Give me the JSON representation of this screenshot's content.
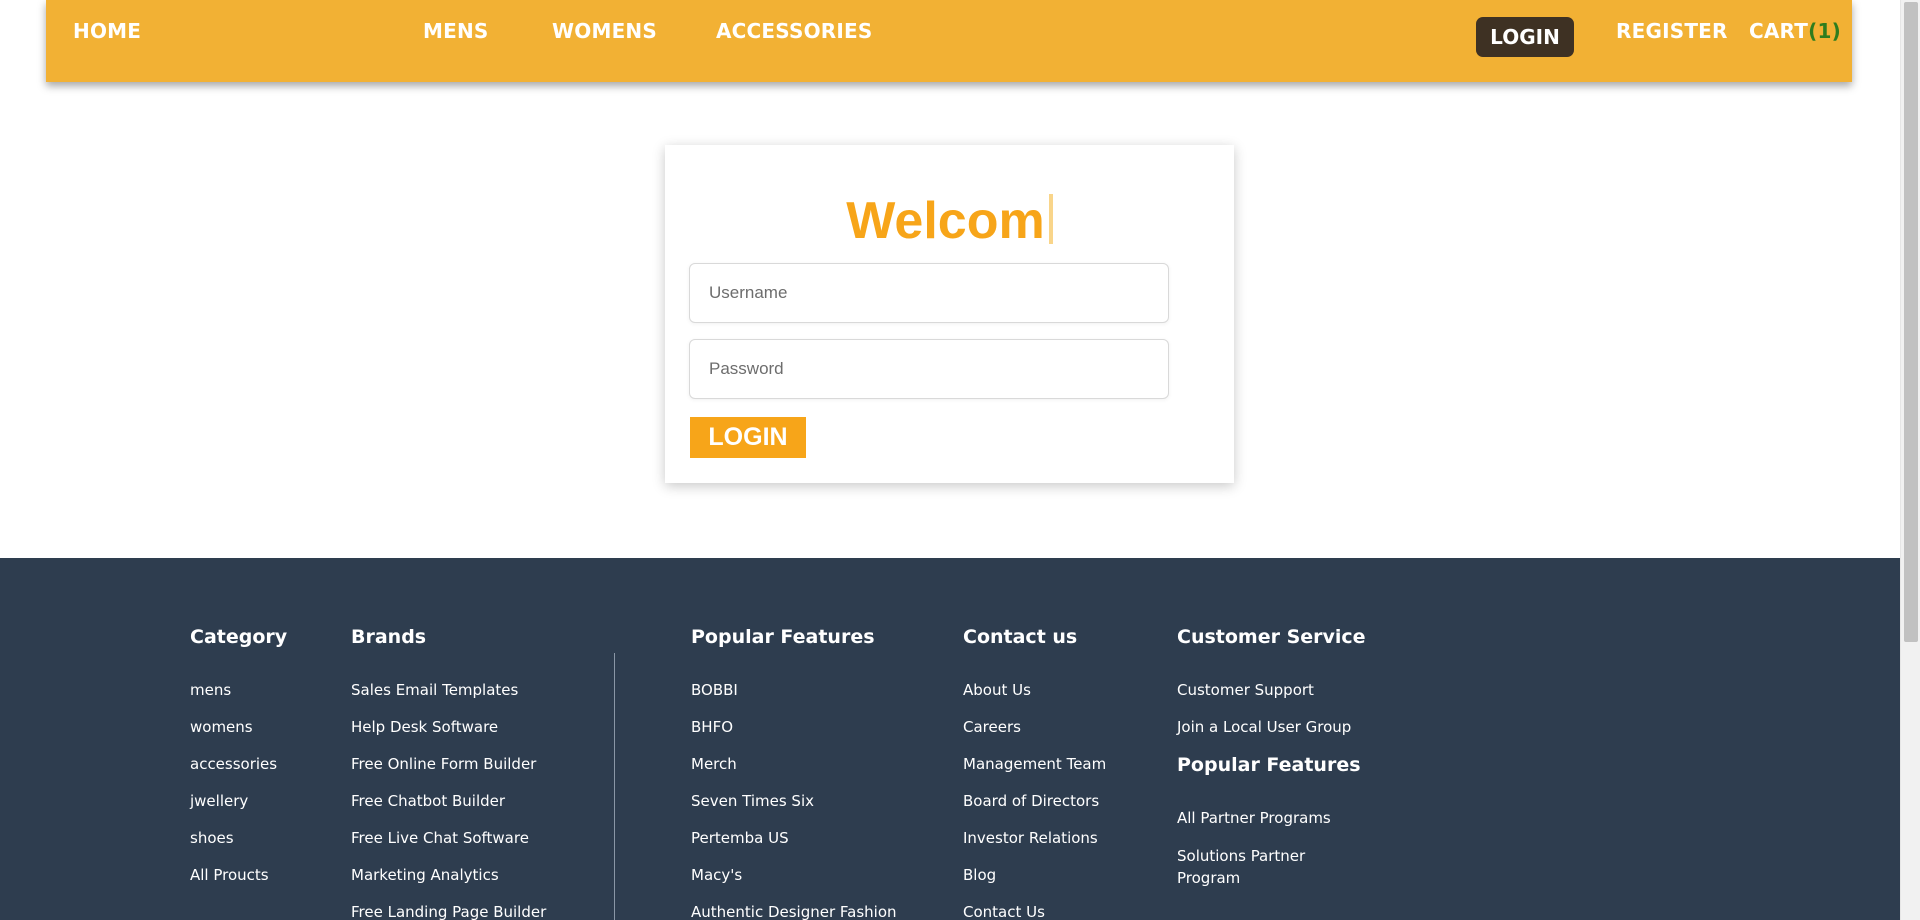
{
  "nav": {
    "home": "HOME",
    "mens": "MENS",
    "womens": "WOMENS",
    "accessories": "ACCESSORIES",
    "login": "LOGIN",
    "register": "REGISTER",
    "cart_label": "CART",
    "cart_count": "(1)"
  },
  "login": {
    "welcome": "Welcom",
    "username_placeholder": "Username",
    "password_placeholder": "Password",
    "button": "LOGIN"
  },
  "footer": {
    "category": {
      "title": "Category",
      "items": [
        "mens",
        "womens",
        "accessories",
        "jwellery",
        "shoes",
        "All Proucts"
      ]
    },
    "brands": {
      "title": "Brands",
      "items": [
        "Sales Email Templates",
        "Help Desk Software",
        "Free Online Form Builder",
        "Free Chatbot Builder",
        "Free Live Chat Software",
        "Marketing Analytics",
        "Free Landing Page Builder"
      ]
    },
    "popular": {
      "title": "Popular Features",
      "items": [
        "BOBBI",
        "BHFO",
        "Merch",
        "Seven Times Six",
        "Pertemba US",
        "Macy's",
        "Authentic Designer Fashion"
      ]
    },
    "contact": {
      "title": "Contact us",
      "items": [
        "About Us",
        "Careers",
        "Management Team",
        "Board of Directors",
        "Investor Relations",
        "Blog",
        "Contact Us"
      ]
    },
    "service": {
      "title": "Customer Service",
      "items": [
        "Customer Support",
        "Join a Local User Group"
      ],
      "sub_title": "Popular Features",
      "sub_items": [
        "All Partner Programs",
        "Solutions Partner Program"
      ]
    }
  },
  "colors": {
    "navbar": "#f2b134",
    "accent": "#f7a519",
    "login_pill": "#3e3123",
    "footer": "#2e3d4f",
    "cart_count": "#2e7d1e"
  }
}
